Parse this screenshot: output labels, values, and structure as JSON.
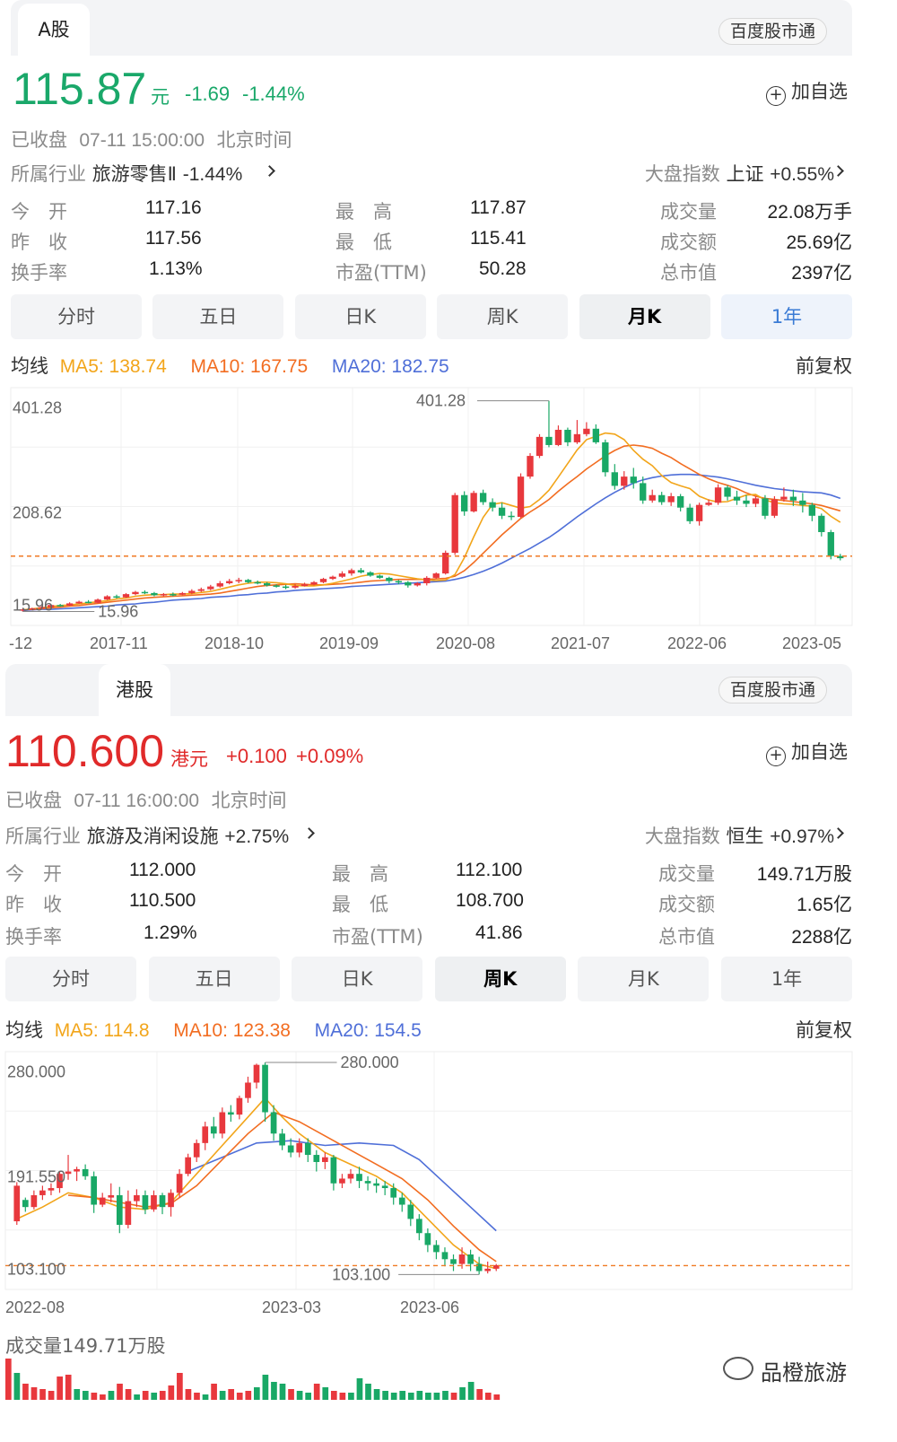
{
  "a_share": {
    "market_tab": "A股",
    "stock_connect": "百度股市通",
    "price": "115.87",
    "currency": "元",
    "change": "-1.69",
    "change_pct": "-1.44%",
    "add_watch": "加自选",
    "status": "已收盘",
    "datetime": "07-11 15:00:00",
    "timezone": "北京时间",
    "industry_label": "所属行业",
    "industry_name": "旅游零售Ⅱ",
    "industry_change": "-1.44%",
    "index_label": "大盘指数",
    "index_name": "上证",
    "index_change": "+0.55%",
    "quote": {
      "open_label": "今　开",
      "open": "117.16",
      "prev_label": "昨　收",
      "prev": "117.56",
      "turnover_rate_label": "换手率",
      "turnover_rate": "1.13%",
      "high_label": "最　高",
      "high": "117.87",
      "low_label": "最　低",
      "low": "115.41",
      "pe_label": "市盈(TTM)",
      "pe": "50.28",
      "volume_label": "成交量",
      "volume": "22.08万手",
      "amount_label": "成交额",
      "amount": "25.69亿",
      "mcap_label": "总市值",
      "mcap": "2397亿"
    },
    "periods": [
      "分时",
      "五日",
      "日K",
      "周K",
      "月K",
      "1年"
    ],
    "active_period": 4,
    "ma_label": "均线",
    "ma5": "MA5: 138.74",
    "ma10": "MA10: 167.75",
    "ma20": "MA20: 182.75",
    "adjust": "前复权"
  },
  "hk_share": {
    "market_tab": "港股",
    "stock_connect": "百度股市通",
    "price": "110.600",
    "currency": "港元",
    "change": "+0.100",
    "change_pct": "+0.09%",
    "add_watch": "加自选",
    "status": "已收盘",
    "datetime": "07-11 16:00:00",
    "timezone": "北京时间",
    "industry_label": "所属行业",
    "industry_name": "旅游及消闲设施",
    "industry_change": "+2.75%",
    "index_label": "大盘指数",
    "index_name": "恒生",
    "index_change": "+0.97%",
    "quote": {
      "open_label": "今　开",
      "open": "112.000",
      "prev_label": "昨　收",
      "prev": "110.500",
      "turnover_rate_label": "换手率",
      "turnover_rate": "1.29%",
      "high_label": "最　高",
      "high": "112.100",
      "low_label": "最　低",
      "low": "108.700",
      "pe_label": "市盈(TTM)",
      "pe": "41.86",
      "volume_label": "成交量",
      "volume": "149.71万股",
      "amount_label": "成交额",
      "amount": "1.65亿",
      "mcap_label": "总市值",
      "mcap": "2288亿"
    },
    "periods": [
      "分时",
      "五日",
      "日K",
      "周K",
      "月K",
      "1年"
    ],
    "active_period": 3,
    "ma_label": "均线",
    "ma5": "MA5: 114.8",
    "ma10": "MA10: 123.38",
    "ma20": "MA20: 154.5",
    "adjust": "前复权",
    "volume_caption": "成交量149.71万股"
  },
  "watermark": "品橙旅游",
  "chart_data": [
    {
      "type": "candlestick",
      "title": "",
      "y_tick_labels": [
        "401.28",
        "208.62",
        "15.96"
      ],
      "ylim": [
        15.96,
        401.28
      ],
      "x_tick_labels": [
        "-12",
        "2017-11",
        "2018-10",
        "2019-09",
        "2020-08",
        "2021-07",
        "2022-06",
        "2023-05"
      ],
      "max_label": "401.28",
      "min_label": "15.96",
      "reference_price": 115.87,
      "candles": [
        [
          16,
          18,
          14,
          19
        ],
        [
          18,
          20,
          17,
          21
        ],
        [
          20,
          22,
          19,
          24
        ],
        [
          22,
          26,
          21,
          27
        ],
        [
          26,
          25,
          23,
          28
        ],
        [
          25,
          29,
          24,
          31
        ],
        [
          29,
          32,
          28,
          34
        ],
        [
          32,
          30,
          29,
          35
        ],
        [
          30,
          36,
          29,
          38
        ],
        [
          36,
          42,
          35,
          44
        ],
        [
          42,
          40,
          38,
          45
        ],
        [
          40,
          46,
          39,
          48
        ],
        [
          46,
          50,
          44,
          52
        ],
        [
          50,
          48,
          46,
          53
        ],
        [
          48,
          44,
          42,
          50
        ],
        [
          44,
          46,
          42,
          48
        ],
        [
          46,
          45,
          42,
          49
        ],
        [
          45,
          48,
          44,
          50
        ],
        [
          48,
          52,
          46,
          55
        ],
        [
          52,
          55,
          50,
          58
        ],
        [
          55,
          60,
          53,
          63
        ],
        [
          60,
          66,
          58,
          70
        ],
        [
          66,
          70,
          64,
          74
        ],
        [
          70,
          72,
          66,
          76
        ],
        [
          72,
          68,
          66,
          74
        ],
        [
          68,
          66,
          64,
          71
        ],
        [
          66,
          62,
          60,
          68
        ],
        [
          62,
          60,
          58,
          64
        ],
        [
          60,
          58,
          55,
          63
        ],
        [
          58,
          61,
          56,
          64
        ],
        [
          61,
          64,
          60,
          67
        ],
        [
          64,
          68,
          62,
          70
        ],
        [
          68,
          74,
          66,
          76
        ],
        [
          74,
          78,
          72,
          80
        ],
        [
          78,
          84,
          76,
          88
        ],
        [
          84,
          90,
          80,
          93
        ],
        [
          90,
          86,
          84,
          94
        ],
        [
          86,
          80,
          78,
          88
        ],
        [
          80,
          76,
          74,
          82
        ],
        [
          76,
          70,
          66,
          78
        ],
        [
          70,
          68,
          64,
          72
        ],
        [
          68,
          62,
          58,
          70
        ],
        [
          62,
          66,
          60,
          68
        ],
        [
          66,
          76,
          62,
          79
        ],
        [
          76,
          84,
          74,
          86
        ],
        [
          84,
          122,
          82,
          126
        ],
        [
          122,
          228,
          118,
          232
        ],
        [
          228,
          198,
          190,
          235
        ],
        [
          198,
          232,
          196,
          236
        ],
        [
          232,
          215,
          210,
          238
        ],
        [
          215,
          205,
          198,
          222
        ],
        [
          205,
          190,
          184,
          214
        ],
        [
          190,
          188,
          182,
          198
        ],
        [
          188,
          262,
          186,
          268
        ],
        [
          262,
          300,
          258,
          305
        ],
        [
          300,
          335,
          296,
          340
        ],
        [
          335,
          320,
          316,
          401.28
        ],
        [
          320,
          348,
          318,
          356
        ],
        [
          348,
          325,
          318,
          352
        ],
        [
          325,
          340,
          322,
          366
        ],
        [
          340,
          350,
          336,
          362
        ],
        [
          350,
          325,
          322,
          358
        ],
        [
          325,
          270,
          262,
          330
        ],
        [
          270,
          245,
          238,
          285
        ],
        [
          245,
          262,
          238,
          272
        ],
        [
          262,
          250,
          240,
          278
        ],
        [
          250,
          218,
          212,
          262
        ],
        [
          218,
          228,
          214,
          238
        ],
        [
          228,
          215,
          210,
          234
        ],
        [
          215,
          226,
          208,
          232
        ],
        [
          226,
          205,
          198,
          230
        ],
        [
          205,
          180,
          175,
          212
        ],
        [
          180,
          210,
          172,
          214
        ],
        [
          210,
          214,
          208,
          220
        ],
        [
          214,
          242,
          210,
          248
        ],
        [
          242,
          225,
          218,
          246
        ],
        [
          225,
          218,
          210,
          236
        ],
        [
          218,
          212,
          206,
          228
        ],
        [
          212,
          222,
          206,
          226
        ],
        [
          222,
          190,
          184,
          228
        ],
        [
          190,
          220,
          186,
          226
        ],
        [
          220,
          225,
          216,
          242
        ],
        [
          225,
          218,
          208,
          238
        ],
        [
          218,
          210,
          196,
          232
        ],
        [
          210,
          190,
          180,
          214
        ],
        [
          190,
          160,
          152,
          194
        ],
        [
          160,
          116,
          110,
          164
        ],
        [
          116,
          112,
          108,
          120
        ]
      ],
      "ma5": [
        17,
        19,
        21,
        23,
        25,
        26,
        28,
        30,
        32,
        34,
        37,
        39,
        42,
        44,
        45,
        45,
        46,
        46,
        47,
        49,
        51,
        55,
        59,
        63,
        66,
        68,
        68,
        67,
        65,
        62,
        61,
        61,
        63,
        66,
        70,
        74,
        79,
        82,
        84,
        83,
        80,
        77,
        74,
        72,
        71,
        72,
        82,
        113,
        151,
        187,
        211,
        214,
        209,
        204,
        207,
        220,
        237,
        261,
        286,
        311,
        330,
        336,
        342,
        340,
        330,
        310,
        294,
        282,
        264,
        251,
        245,
        240,
        226,
        219,
        215,
        216,
        222,
        228,
        229,
        219,
        214,
        212,
        211,
        209,
        208,
        203,
        189,
        178
      ],
      "ma10": [
        17,
        18,
        19,
        21,
        22,
        24,
        25,
        27,
        29,
        31,
        33,
        35,
        37,
        39,
        40,
        41,
        42,
        43,
        44,
        45,
        46,
        48,
        51,
        54,
        57,
        60,
        62,
        63,
        64,
        65,
        64,
        63,
        63,
        64,
        65,
        66,
        68,
        70,
        71,
        72,
        73,
        73,
        73,
        73,
        74,
        75,
        79,
        89,
        104,
        121,
        138,
        155,
        170,
        185,
        197,
        208,
        220,
        235,
        249,
        262,
        276,
        288,
        300,
        310,
        318,
        320,
        318,
        314,
        305,
        297,
        286,
        276,
        266,
        258,
        251,
        246,
        240,
        232,
        226,
        222,
        220,
        218,
        216,
        214,
        212,
        209,
        204,
        199
      ],
      "ma20": [
        16,
        17,
        18,
        18,
        19,
        20,
        21,
        22,
        23,
        24,
        26,
        27,
        28,
        30,
        31,
        33,
        35,
        36,
        37,
        38,
        40,
        41,
        42,
        44,
        45,
        47,
        48,
        50,
        51,
        53,
        54,
        55,
        56,
        57,
        58,
        60,
        61,
        62,
        63,
        64,
        65,
        66,
        67,
        68,
        69,
        70,
        73,
        77,
        82,
        88,
        95,
        103,
        112,
        121,
        130,
        140,
        150,
        162,
        175,
        188,
        200,
        212,
        223,
        233,
        242,
        250,
        256,
        260,
        263,
        265,
        266,
        266,
        265,
        263,
        261,
        258,
        254,
        250,
        246,
        243,
        240,
        238,
        236,
        234,
        233,
        232,
        228,
        222
      ]
    },
    {
      "type": "candlestick",
      "title": "",
      "y_tick_labels": [
        "280.000",
        "191.550",
        "103.100"
      ],
      "ylim": [
        103.1,
        280.0
      ],
      "x_tick_labels": [
        "2022-08",
        "2023-03",
        "2023-06"
      ],
      "max_label": "280.000",
      "min_label": "103.100",
      "reference_price": 110.6,
      "volume_caption": "成交量149.71万股",
      "candles": [
        [
          148,
          178,
          145,
          181
        ],
        [
          166,
          160,
          156,
          168
        ],
        [
          160,
          170,
          158,
          174
        ],
        [
          170,
          174,
          166,
          178
        ],
        [
          174,
          176,
          170,
          180
        ],
        [
          176,
          188,
          172,
          190
        ],
        [
          188,
          190,
          183,
          204
        ],
        [
          190,
          192,
          182,
          194
        ],
        [
          192,
          186,
          183,
          196
        ],
        [
          186,
          162,
          155,
          190
        ],
        [
          162,
          168,
          160,
          172
        ],
        [
          168,
          170,
          164,
          180
        ],
        [
          170,
          145,
          138,
          177
        ],
        [
          145,
          165,
          142,
          174
        ],
        [
          165,
          170,
          160,
          175
        ],
        [
          170,
          158,
          154,
          174
        ],
        [
          158,
          170,
          156,
          174
        ],
        [
          170,
          160,
          154,
          172
        ],
        [
          160,
          172,
          152,
          175
        ],
        [
          172,
          188,
          168,
          192
        ],
        [
          188,
          202,
          186,
          205
        ],
        [
          202,
          214,
          198,
          217
        ],
        [
          214,
          228,
          208,
          232
        ],
        [
          228,
          222,
          218,
          236
        ],
        [
          222,
          240,
          218,
          244
        ],
        [
          240,
          238,
          232,
          246
        ],
        [
          238,
          252,
          234,
          254
        ],
        [
          252,
          265,
          248,
          270
        ],
        [
          265,
          280,
          260,
          281
        ],
        [
          280,
          240,
          232,
          282
        ],
        [
          240,
          222,
          216,
          246
        ],
        [
          222,
          212,
          208,
          226
        ],
        [
          212,
          206,
          202,
          218
        ],
        [
          206,
          214,
          202,
          218
        ],
        [
          214,
          204,
          198,
          218
        ],
        [
          204,
          198,
          190,
          208
        ],
        [
          198,
          202,
          192,
          206
        ],
        [
          202,
          180,
          174,
          204
        ],
        [
          180,
          184,
          176,
          188
        ],
        [
          184,
          188,
          180,
          192
        ],
        [
          188,
          182,
          176,
          194
        ],
        [
          182,
          180,
          174,
          186
        ],
        [
          180,
          178,
          172,
          184
        ],
        [
          178,
          176,
          170,
          182
        ],
        [
          176,
          168,
          162,
          180
        ],
        [
          168,
          162,
          156,
          172
        ],
        [
          162,
          150,
          144,
          166
        ],
        [
          150,
          138,
          132,
          154
        ],
        [
          138,
          128,
          122,
          142
        ],
        [
          128,
          122,
          116,
          132
        ],
        [
          122,
          116,
          110,
          126
        ],
        [
          116,
          112,
          106,
          120
        ],
        [
          112,
          120,
          108,
          126
        ],
        [
          120,
          112,
          106,
          124
        ],
        [
          112,
          106,
          103.1,
          118
        ],
        [
          106,
          108,
          104,
          114
        ],
        [
          108,
          111,
          106,
          112
        ]
      ],
      "volume": [
        46,
        30,
        18,
        14,
        12,
        10,
        26,
        28,
        12,
        10,
        8,
        6,
        10,
        18,
        12,
        6,
        10,
        8,
        10,
        16,
        30,
        12,
        8,
        6,
        18,
        10,
        12,
        8,
        10,
        14,
        28,
        20,
        18,
        12,
        10,
        8,
        18,
        14,
        10,
        8,
        8,
        24,
        18,
        12,
        10,
        8,
        10,
        8,
        10,
        8,
        8,
        10,
        8,
        14,
        20,
        12,
        8,
        6
      ]
    }
  ]
}
